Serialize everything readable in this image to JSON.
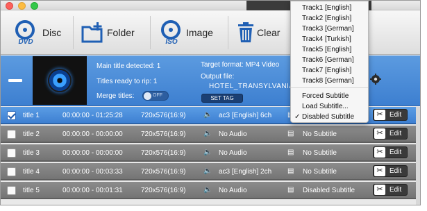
{
  "window": {
    "title": "M... ...P"
  },
  "toolbar": {
    "disc_label": "Disc",
    "disc_icon_text": "DVD",
    "folder_label": "Folder",
    "image_label": "Image",
    "image_icon_text": "ISO",
    "clear_label": "Clear"
  },
  "panel": {
    "main_title": "Main title detected: 1",
    "titles_ready": "Titles ready to rip: 1",
    "merge_label": "Merge titles:",
    "merge_toggle": "OFF",
    "target_format": "Target format: MP4 Video",
    "output_label": "Output file:",
    "output_name": "HOTEL_TRANSYLVANIA",
    "settag_label": "SET TAG"
  },
  "rows": [
    {
      "checked": true,
      "name": "title 1",
      "time": "00:00:00 - 01:25:28",
      "res": "720x576(16:9)",
      "audio": "ac3 [English] 6ch",
      "subtitle": "",
      "edit": "Edit"
    },
    {
      "checked": false,
      "name": "title 2",
      "time": "00:00:00 - 00:00:00",
      "res": "720x576(16:9)",
      "audio": "No Audio",
      "subtitle": "No Subtitle",
      "edit": "Edit"
    },
    {
      "checked": false,
      "name": "title 3",
      "time": "00:00:00 - 00:00:00",
      "res": "720x576(16:9)",
      "audio": "No Audio",
      "subtitle": "No Subtitle",
      "edit": "Edit"
    },
    {
      "checked": false,
      "name": "title 4",
      "time": "00:00:00 - 00:03:33",
      "res": "720x576(16:9)",
      "audio": "ac3 [English] 2ch",
      "subtitle": "No Subtitle",
      "edit": "Edit"
    },
    {
      "checked": false,
      "name": "title 5",
      "time": "00:00:00 - 00:01:31",
      "res": "720x576(16:9)",
      "audio": "No Audio",
      "subtitle": "Disabled Subtitle",
      "edit": "Edit"
    }
  ],
  "dropdown": {
    "items": [
      "Track1 [English]",
      "Track2 [English]",
      "Track3 [German]",
      "Track4 [Turkish]",
      "Track5 [English]",
      "Track6 [German]",
      "Track7 [English]",
      "Track8 [German]",
      "Forced Subtitle",
      "Load Subtitle...",
      "Disabled Subtitle"
    ],
    "checked_item": "Disabled Subtitle",
    "check_mark": "✓"
  },
  "colors": {
    "panel_blue": "#4a8bd8",
    "selected_row": "#4c8ddb",
    "row_gray": "#808080",
    "icon_blue": "#1f5fb4"
  }
}
